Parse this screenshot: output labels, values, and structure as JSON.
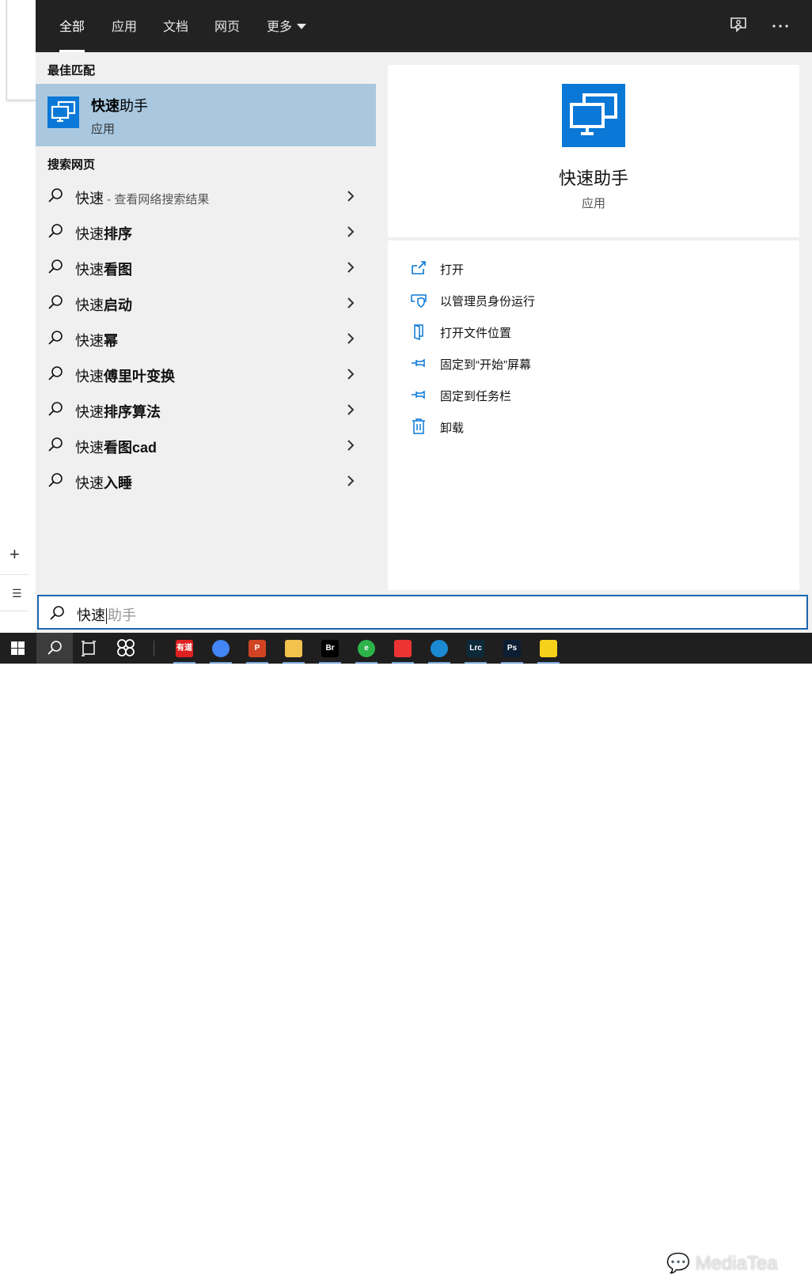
{
  "tabs": [
    {
      "label": "全部",
      "active": true
    },
    {
      "label": "应用",
      "active": false
    },
    {
      "label": "文档",
      "active": false
    },
    {
      "label": "网页",
      "active": false
    },
    {
      "label": "更多",
      "active": false
    }
  ],
  "best_match": {
    "section_title": "最佳匹配",
    "name_bold": "快速",
    "name_rest": "助手",
    "type": "应用"
  },
  "web_search": {
    "section_title": "搜索网页",
    "items": [
      {
        "prefix": "快速",
        "bold": "",
        "sub": " - 查看网络搜索结果"
      },
      {
        "prefix": "快速",
        "bold": "排序",
        "sub": ""
      },
      {
        "prefix": "快速",
        "bold": "看图",
        "sub": ""
      },
      {
        "prefix": "快速",
        "bold": "启动",
        "sub": ""
      },
      {
        "prefix": "快速",
        "bold": "幂",
        "sub": ""
      },
      {
        "prefix": "快速",
        "bold": "傅里叶变换",
        "sub": ""
      },
      {
        "prefix": "快速",
        "bold": "排序算法",
        "sub": ""
      },
      {
        "prefix": "快速",
        "bold": "看图cad",
        "sub": ""
      },
      {
        "prefix": "快速",
        "bold": "入睡",
        "sub": ""
      }
    ]
  },
  "detail": {
    "app_name": "快速助手",
    "app_type": "应用",
    "actions": [
      {
        "label": "打开",
        "icon": "open-icon"
      },
      {
        "label": "以管理员身份运行",
        "icon": "shield-icon"
      },
      {
        "label": "打开文件位置",
        "icon": "folder-icon"
      },
      {
        "label": "固定到“开始”屏幕",
        "icon": "pin-icon"
      },
      {
        "label": "固定到任务栏",
        "icon": "pin-icon"
      },
      {
        "label": "卸载",
        "icon": "trash-icon"
      }
    ]
  },
  "search_box": {
    "typed": "快速",
    "suggestion": "助手"
  },
  "taskbar": {
    "apps": [
      {
        "name": "youdao",
        "label": "有道",
        "color": "#e02020"
      },
      {
        "name": "chrome",
        "label": "",
        "color": "#4285f4"
      },
      {
        "name": "powerpoint",
        "label": "P",
        "color": "#d04423"
      },
      {
        "name": "explorer",
        "label": "",
        "color": "#f2c14e"
      },
      {
        "name": "bridge",
        "label": "Br",
        "color": "#000000"
      },
      {
        "name": "360",
        "label": "e",
        "color": "#2db34a"
      },
      {
        "name": "app-colorful",
        "label": "",
        "color": "#e33"
      },
      {
        "name": "edge",
        "label": "",
        "color": "#1b8ad3"
      },
      {
        "name": "lightroom",
        "label": "Lrc",
        "color": "#0a2a3a"
      },
      {
        "name": "photoshop",
        "label": "Ps",
        "color": "#0b1e33"
      },
      {
        "name": "sticky-notes",
        "label": "",
        "color": "#f6d11a"
      }
    ]
  },
  "watermark": "MediaTea",
  "colors": {
    "accent": "#0a78d7",
    "selected_row": "#a9c8e0",
    "topbar": "#222222",
    "panel": "#f0f0f0",
    "search_border": "#1b66b0"
  }
}
